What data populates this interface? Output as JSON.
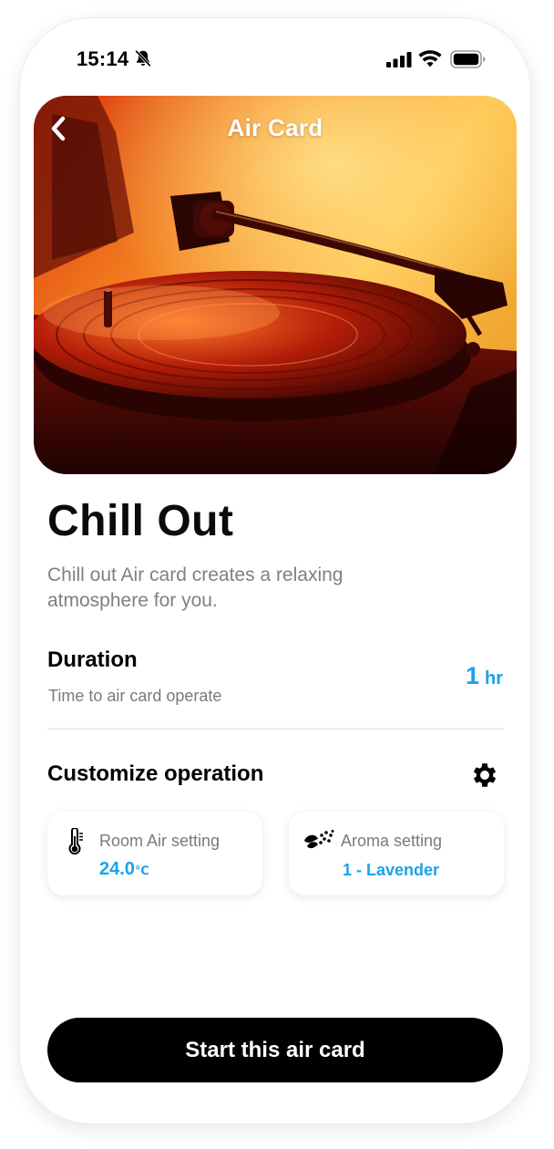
{
  "status_bar": {
    "time": "15:14",
    "icons": [
      "bell-off-icon",
      "signal-icon",
      "wifi-icon",
      "battery-icon"
    ]
  },
  "header": {
    "title": "Air Card",
    "back_icon": "chevron-left-icon"
  },
  "hero": {
    "image": "vinyl-turntable-photo"
  },
  "card": {
    "title": "Chill Out",
    "description": "Chill out Air card creates a relaxing atmosphere for you."
  },
  "duration": {
    "label": "Duration",
    "subtitle": "Time to air card operate",
    "value": "1",
    "unit": "hr"
  },
  "customize": {
    "label": "Customize operation",
    "settings_icon": "gear-icon",
    "room_air": {
      "icon": "thermometer-icon",
      "label": "Room Air setting",
      "value": "24.0",
      "unit": "℃"
    },
    "aroma": {
      "icon": "aroma-icon",
      "label": "Aroma setting",
      "value": "1 - Lavender"
    }
  },
  "actions": {
    "start_label": "Start this air card"
  },
  "colors": {
    "accent": "#1aa3e8",
    "primary_button": "#000000",
    "text_muted": "#808080"
  }
}
